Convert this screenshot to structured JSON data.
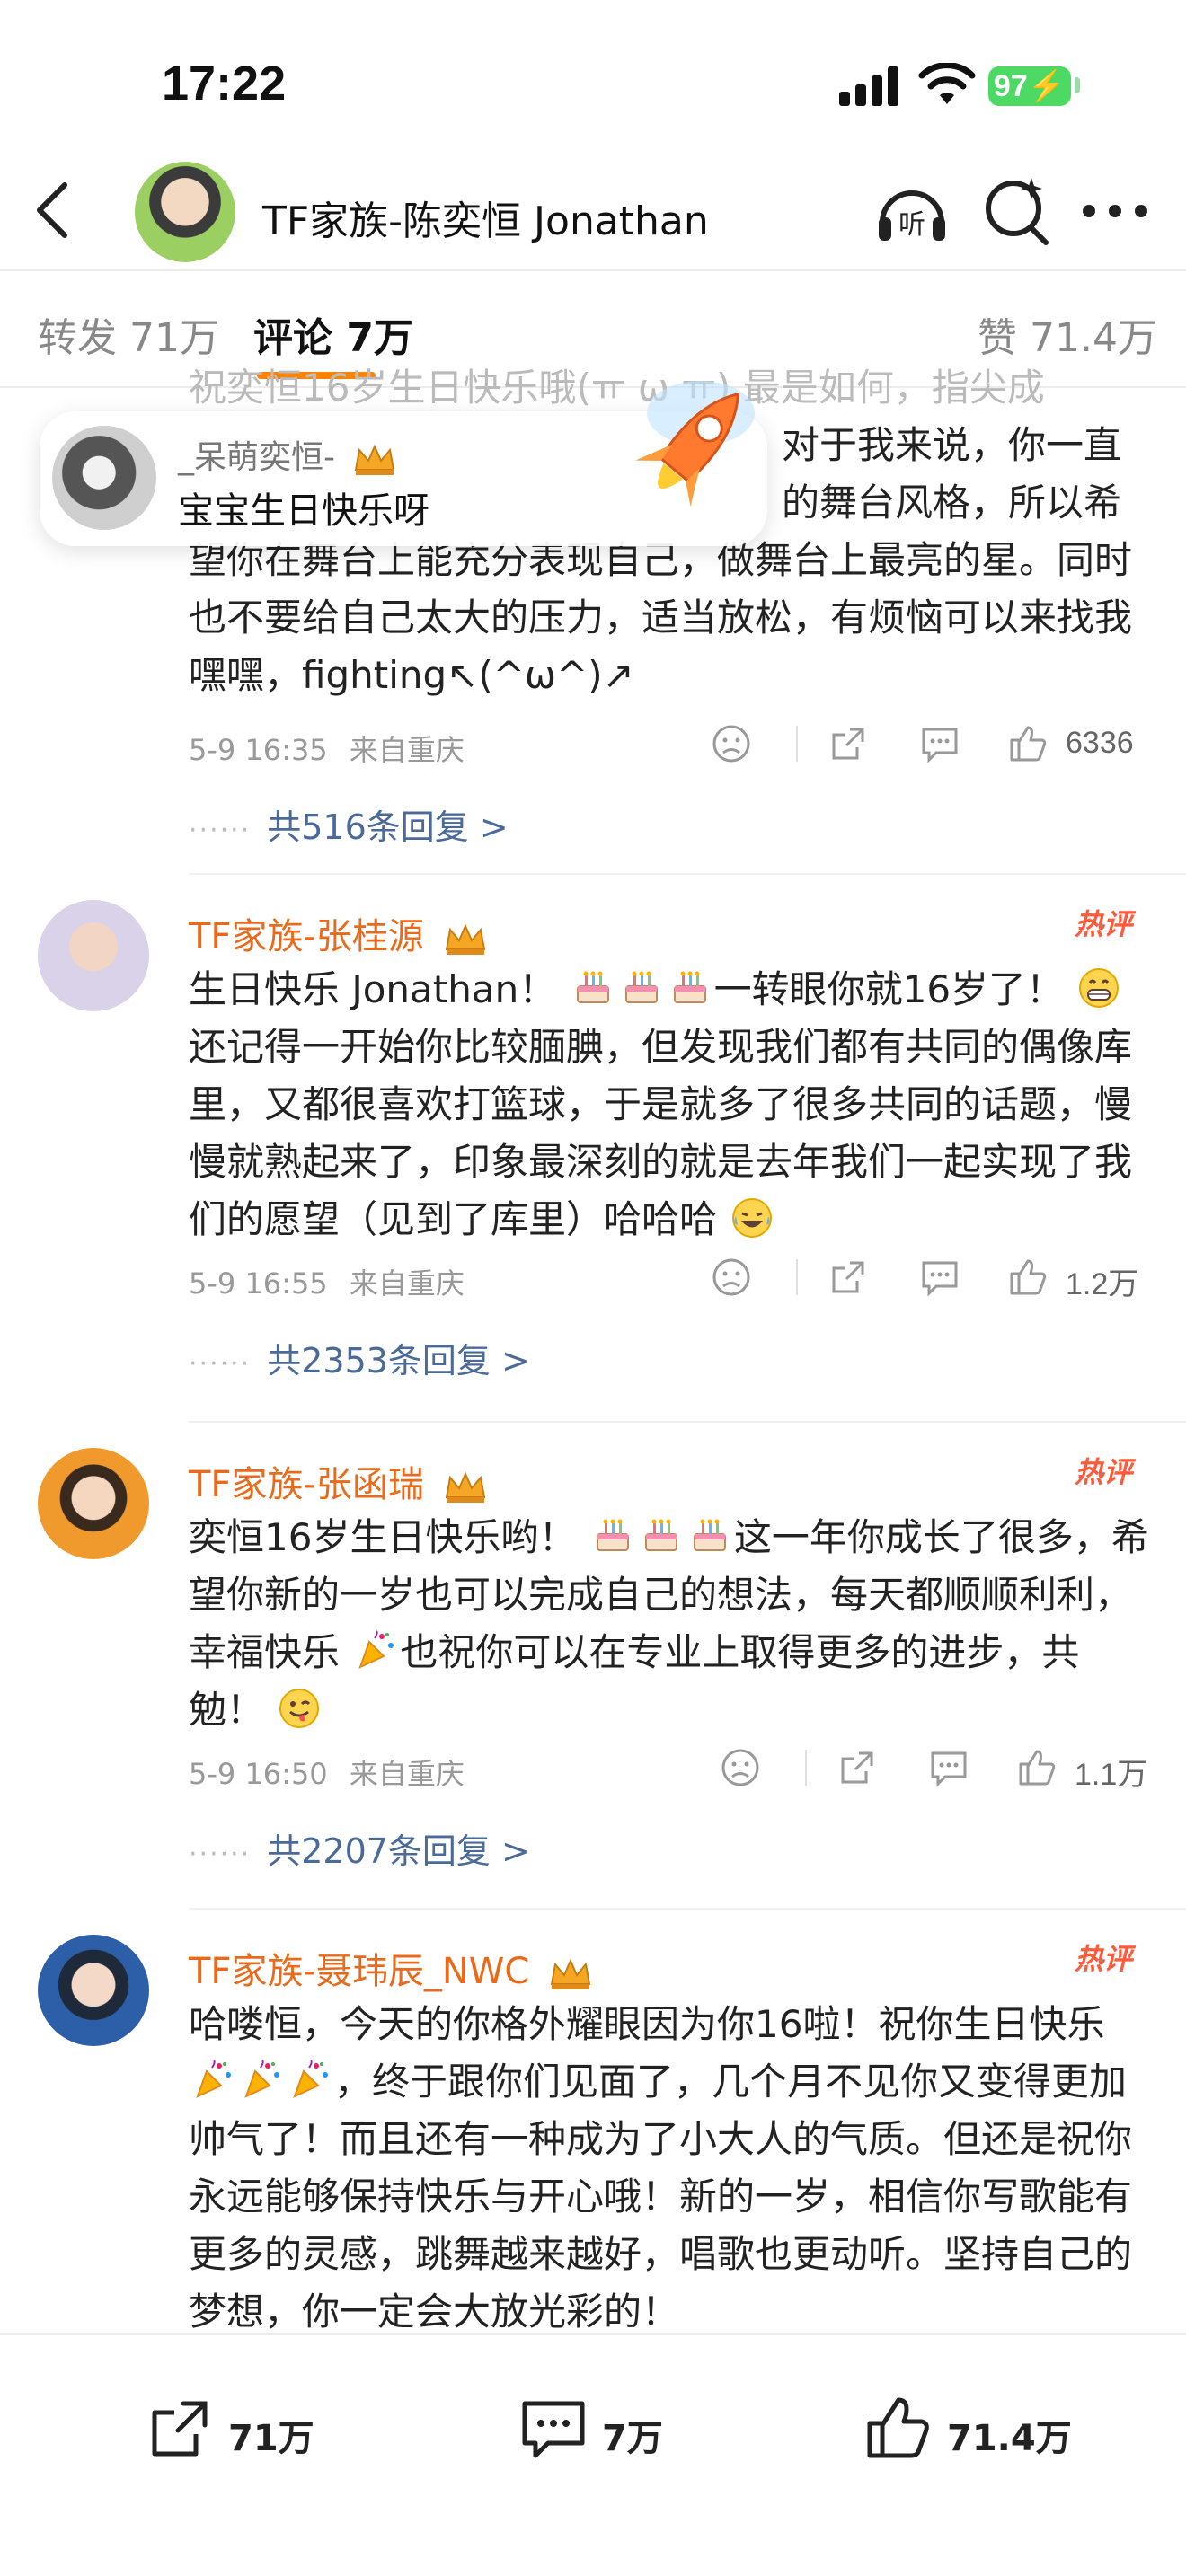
{
  "status_bar": {
    "time": "17:22",
    "battery": "97"
  },
  "nav": {
    "title": "TF家族-陈奕恒 Jonathan"
  },
  "tabs": {
    "repost": "转发 71万",
    "comments": "评论 7万",
    "likes": "赞 71.4万"
  },
  "top_comment": {
    "text_partial_1": "祝奕恒16岁生日快乐哦(ㅠ ω ㅠ) 最是如何，指尖成",
    "text_partial_2": "对于我来说，你一直",
    "text_partial_3": "的舞台风格，所以希",
    "text_lines": "望你在舞台上能充分表现自己，做舞台上最亮的星。同时也不要给自己太大的压力，适当放松，有烦恼可以来找我嘿嘿，fighting↖(^ω^)↗",
    "time": "5-9 16:35",
    "location": "来自重庆",
    "likes": "6336",
    "replies": "共516条回复 >"
  },
  "bubble": {
    "name": "_呆萌奕恒-",
    "text": "宝宝生日快乐呀"
  },
  "comments": [
    {
      "name": "TF家族-张桂源",
      "hot": "热评",
      "text_a": "生日快乐 Jonathan！",
      "text_b": "一转眼你就16岁了！",
      "text_c": "还记得一开始你比较腼腆，但发现我们都有共同的偶像库里，又都很喜欢打篮球，于是就多了很多共同的话题，慢慢就熟起来了，印象最深刻的就是去年我们一起实现了我们的愿望（见到了库里）哈哈哈",
      "time": "5-9 16:55",
      "location": "来自重庆",
      "likes": "1.2万",
      "replies": "共2353条回复 >"
    },
    {
      "name": "TF家族-张函瑞",
      "hot": "热评",
      "text_a": "奕恒16岁生日快乐哟！",
      "text_b": "这一年你成长了很多，希望你新的一岁也可以完成自己的想法，每天都顺顺利利，幸福快乐",
      "text_c": "也祝你可以在专业上取得更多的进步，共勉！",
      "time": "5-9 16:50",
      "location": "来自重庆",
      "likes": "1.1万",
      "replies": "共2207条回复 >"
    },
    {
      "name": "TF家族-聂玮辰_NWC",
      "hot": "热评",
      "text_a": "哈喽恒，今天的你格外耀眼因为你16啦！祝你生日快乐",
      "text_b": "，终于跟你们见面了，几个月不见你又变得更加帅气了！而且还有一种成为了小大人的气质。但还是祝你永远能够保持快乐与开心哦！新的一岁，相信你写歌能有更多的灵感，跳舞越来越好，唱歌也更动听。坚持自己的梦想，你一定会大放光彩的！"
    }
  ],
  "bottom_bar": {
    "repost": "71万",
    "comment": "7万",
    "like": "71.4万"
  },
  "colors": {
    "accent": "#ff8200",
    "name": "#e86a1a",
    "link": "#4a6a9a",
    "battery": "#4cd964"
  }
}
